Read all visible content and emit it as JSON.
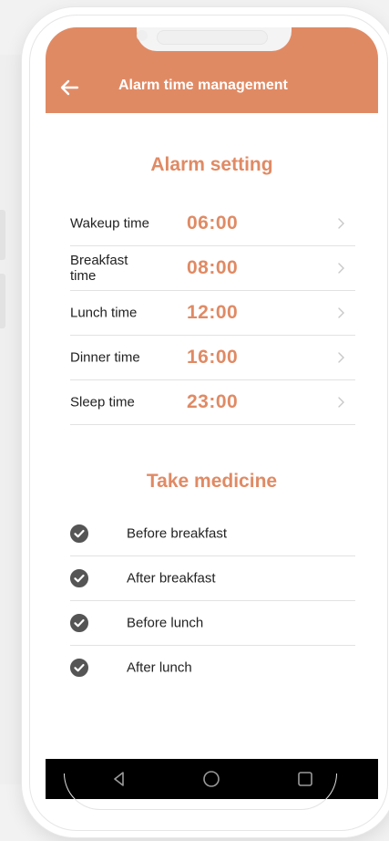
{
  "header": {
    "title": "Alarm time management",
    "back_icon": "arrow-left-icon"
  },
  "alarm_setting": {
    "title": "Alarm setting",
    "rows": [
      {
        "label": "Wakeup time",
        "time": "06:00"
      },
      {
        "label": "Breakfast time",
        "time": "08:00"
      },
      {
        "label": "Lunch time",
        "time": "12:00"
      },
      {
        "label": "Dinner time",
        "time": "16:00"
      },
      {
        "label": "Sleep time",
        "time": "23:00"
      }
    ]
  },
  "take_medicine": {
    "title": "Take medicine",
    "items": [
      {
        "label": "Before breakfast",
        "checked": true
      },
      {
        "label": "After breakfast",
        "checked": true
      },
      {
        "label": "Before lunch",
        "checked": true
      },
      {
        "label": "After lunch",
        "checked": true
      }
    ]
  },
  "navbar": {
    "back_icon": "triangle-back-icon",
    "home_icon": "circle-home-icon",
    "recents_icon": "square-recents-icon"
  },
  "colors": {
    "accent": "#e08a64",
    "check": "#555555",
    "navbar": "#000000"
  }
}
